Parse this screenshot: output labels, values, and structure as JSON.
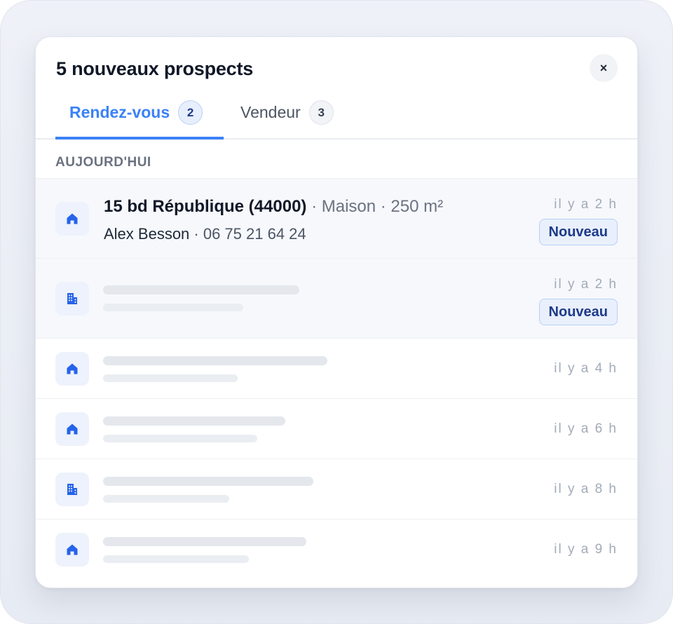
{
  "panel": {
    "title": "5 nouveaux prospects",
    "close_label": "×"
  },
  "tabs": [
    {
      "label": "Rendez-vous",
      "count": "2",
      "active": true
    },
    {
      "label": "Vendeur",
      "count": "3",
      "active": false
    }
  ],
  "section": {
    "label": "AUJOURD'HUI"
  },
  "rows": [
    {
      "icon": "house-icon",
      "address": "15 bd République (44000)",
      "details": " · Maison · 250 m²",
      "contact_name": "Alex Besson",
      "contact_phone": " · 06 75 21 64 24",
      "time": "il y a 2 h",
      "badge": "Nouveau"
    },
    {
      "icon": "building-icon",
      "time": "il y a 2 h",
      "badge": "Nouveau"
    },
    {
      "icon": "house-icon",
      "time": "il y a 4 h"
    },
    {
      "icon": "house-icon",
      "time": "il y a 6 h"
    },
    {
      "icon": "building-icon",
      "time": "il y a 8 h"
    },
    {
      "icon": "house-icon",
      "time": "il y a 9 h"
    }
  ],
  "colors": {
    "accent": "#3b82f6",
    "icon_blue": "#2563eb",
    "highlight_bg": "#f6f8fc",
    "badge_text": "#1e3a8a"
  }
}
